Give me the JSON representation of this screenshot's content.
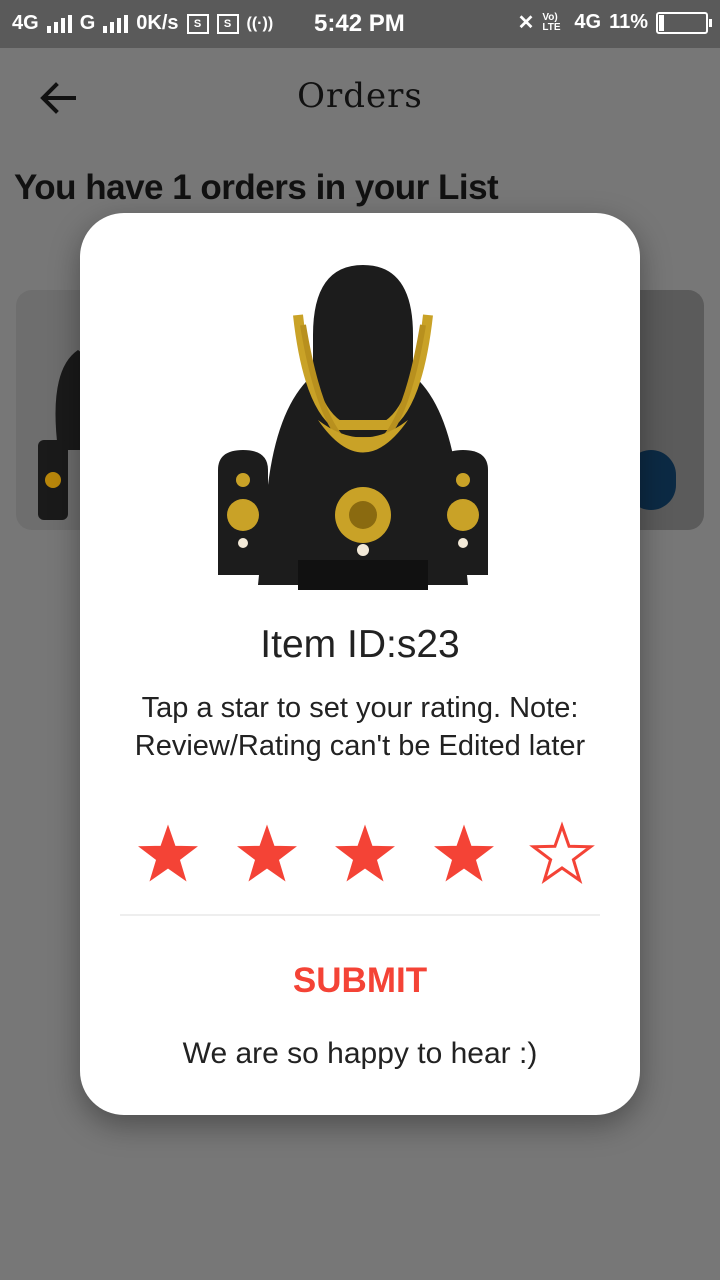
{
  "status_bar": {
    "network1": "4G",
    "network2": "G",
    "speed": "0K/s",
    "time": "5:42 PM",
    "volte": "Vo) LTE",
    "network3": "4G",
    "battery": "11%"
  },
  "app_bar": {
    "title": "Orders",
    "back_icon": "arrow-left-icon"
  },
  "orders_heading": "You have 1 orders in your List",
  "dialog": {
    "item_id": "Item ID:s23",
    "instructions": "Tap a star to set your rating. Note: Review/Rating can't be Edited later",
    "rating": 4,
    "max_rating": 5,
    "star_color": "#f44336",
    "submit_label": "SUBMIT",
    "footer_message": "We are so happy to hear :)"
  }
}
